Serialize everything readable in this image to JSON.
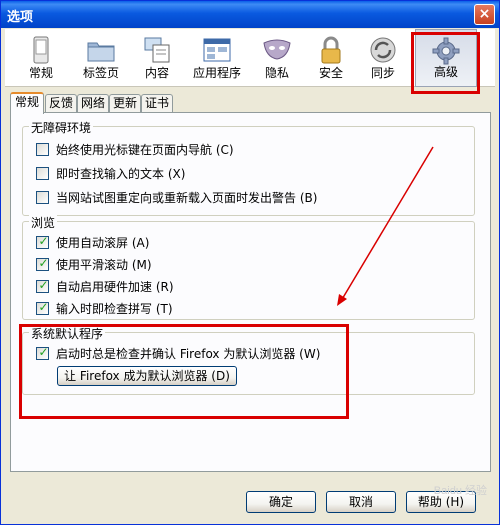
{
  "window": {
    "title": "选项",
    "close_glyph": "×"
  },
  "toolbar": {
    "items": [
      {
        "label": "常规",
        "icon": "phone-icon"
      },
      {
        "label": "标签页",
        "icon": "folder-icon"
      },
      {
        "label": "内容",
        "icon": "content-icon"
      },
      {
        "label": "应用程序",
        "icon": "window-icon"
      },
      {
        "label": "隐私",
        "icon": "mask-icon"
      },
      {
        "label": "安全",
        "icon": "lock-icon"
      },
      {
        "label": "同步",
        "icon": "sync-icon"
      },
      {
        "label": "高级",
        "icon": "gear-icon"
      }
    ],
    "selected": "高级"
  },
  "tabs": [
    {
      "label": "常规"
    },
    {
      "label": "反馈"
    },
    {
      "label": "网络"
    },
    {
      "label": "更新"
    },
    {
      "label": "证书"
    }
  ],
  "accessibility": {
    "title": "无障碍环境",
    "options": [
      {
        "label": "始终使用光标键在页面内导航 (C)",
        "checked": false
      },
      {
        "label": "即时查找输入的文本 (X)",
        "checked": false
      },
      {
        "label": "当网站试图重定向或重新载入页面时发出警告 (B)",
        "checked": false
      }
    ]
  },
  "browsing": {
    "title": "浏览",
    "options": [
      {
        "label": "使用自动滚屏 (A)",
        "checked": true
      },
      {
        "label": "使用平滑滚动 (M)",
        "checked": true
      },
      {
        "label": "自动启用硬件加速 (R)",
        "checked": true
      },
      {
        "label": "输入时即检查拼写 (T)",
        "checked": true
      }
    ]
  },
  "system_defaults": {
    "title": "系统默认程序",
    "check_label": "启动时总是检查并确认 Firefox 为默认浏览器 (W)",
    "checked": true,
    "button_label": "让 Firefox 成为默认浏览器 (D)"
  },
  "footer": {
    "ok": "确定",
    "cancel": "取消",
    "help": "帮助 (H)"
  },
  "watermark": "Baidu 经验"
}
